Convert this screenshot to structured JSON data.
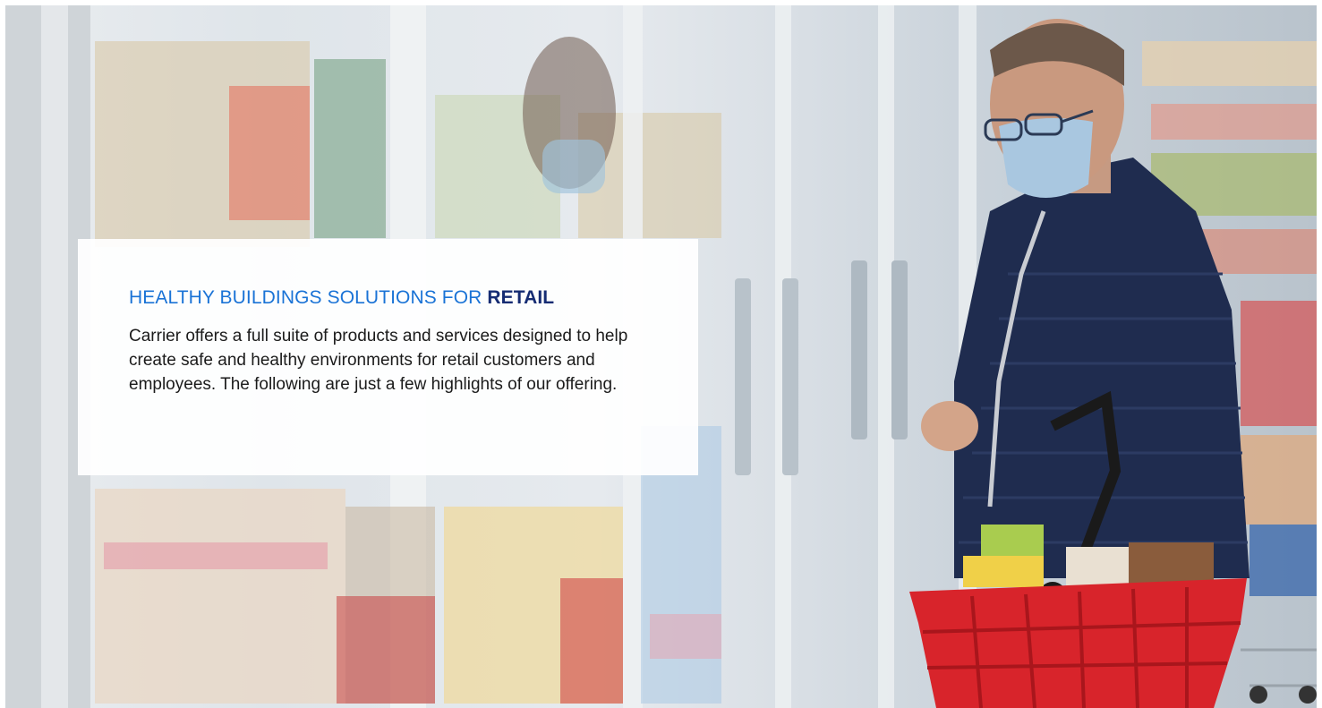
{
  "hero": {
    "image_description_icon": "supermarket-shopper-photo"
  },
  "card": {
    "title_prefix": "HEALTHY BUILDINGS SOLUTIONS FOR ",
    "title_emphasis": "RETAIL",
    "body": "Carrier offers a full suite of products and services designed to help create safe and healthy environments for retail customers and employees. The following are just a few highlights of our offering."
  },
  "colors": {
    "title_blue": "#1a73d6",
    "title_navy": "#152c73",
    "body_text": "#1b1b1b",
    "basket_red": "#d8242b",
    "jacket_navy": "#1f2c4f"
  }
}
